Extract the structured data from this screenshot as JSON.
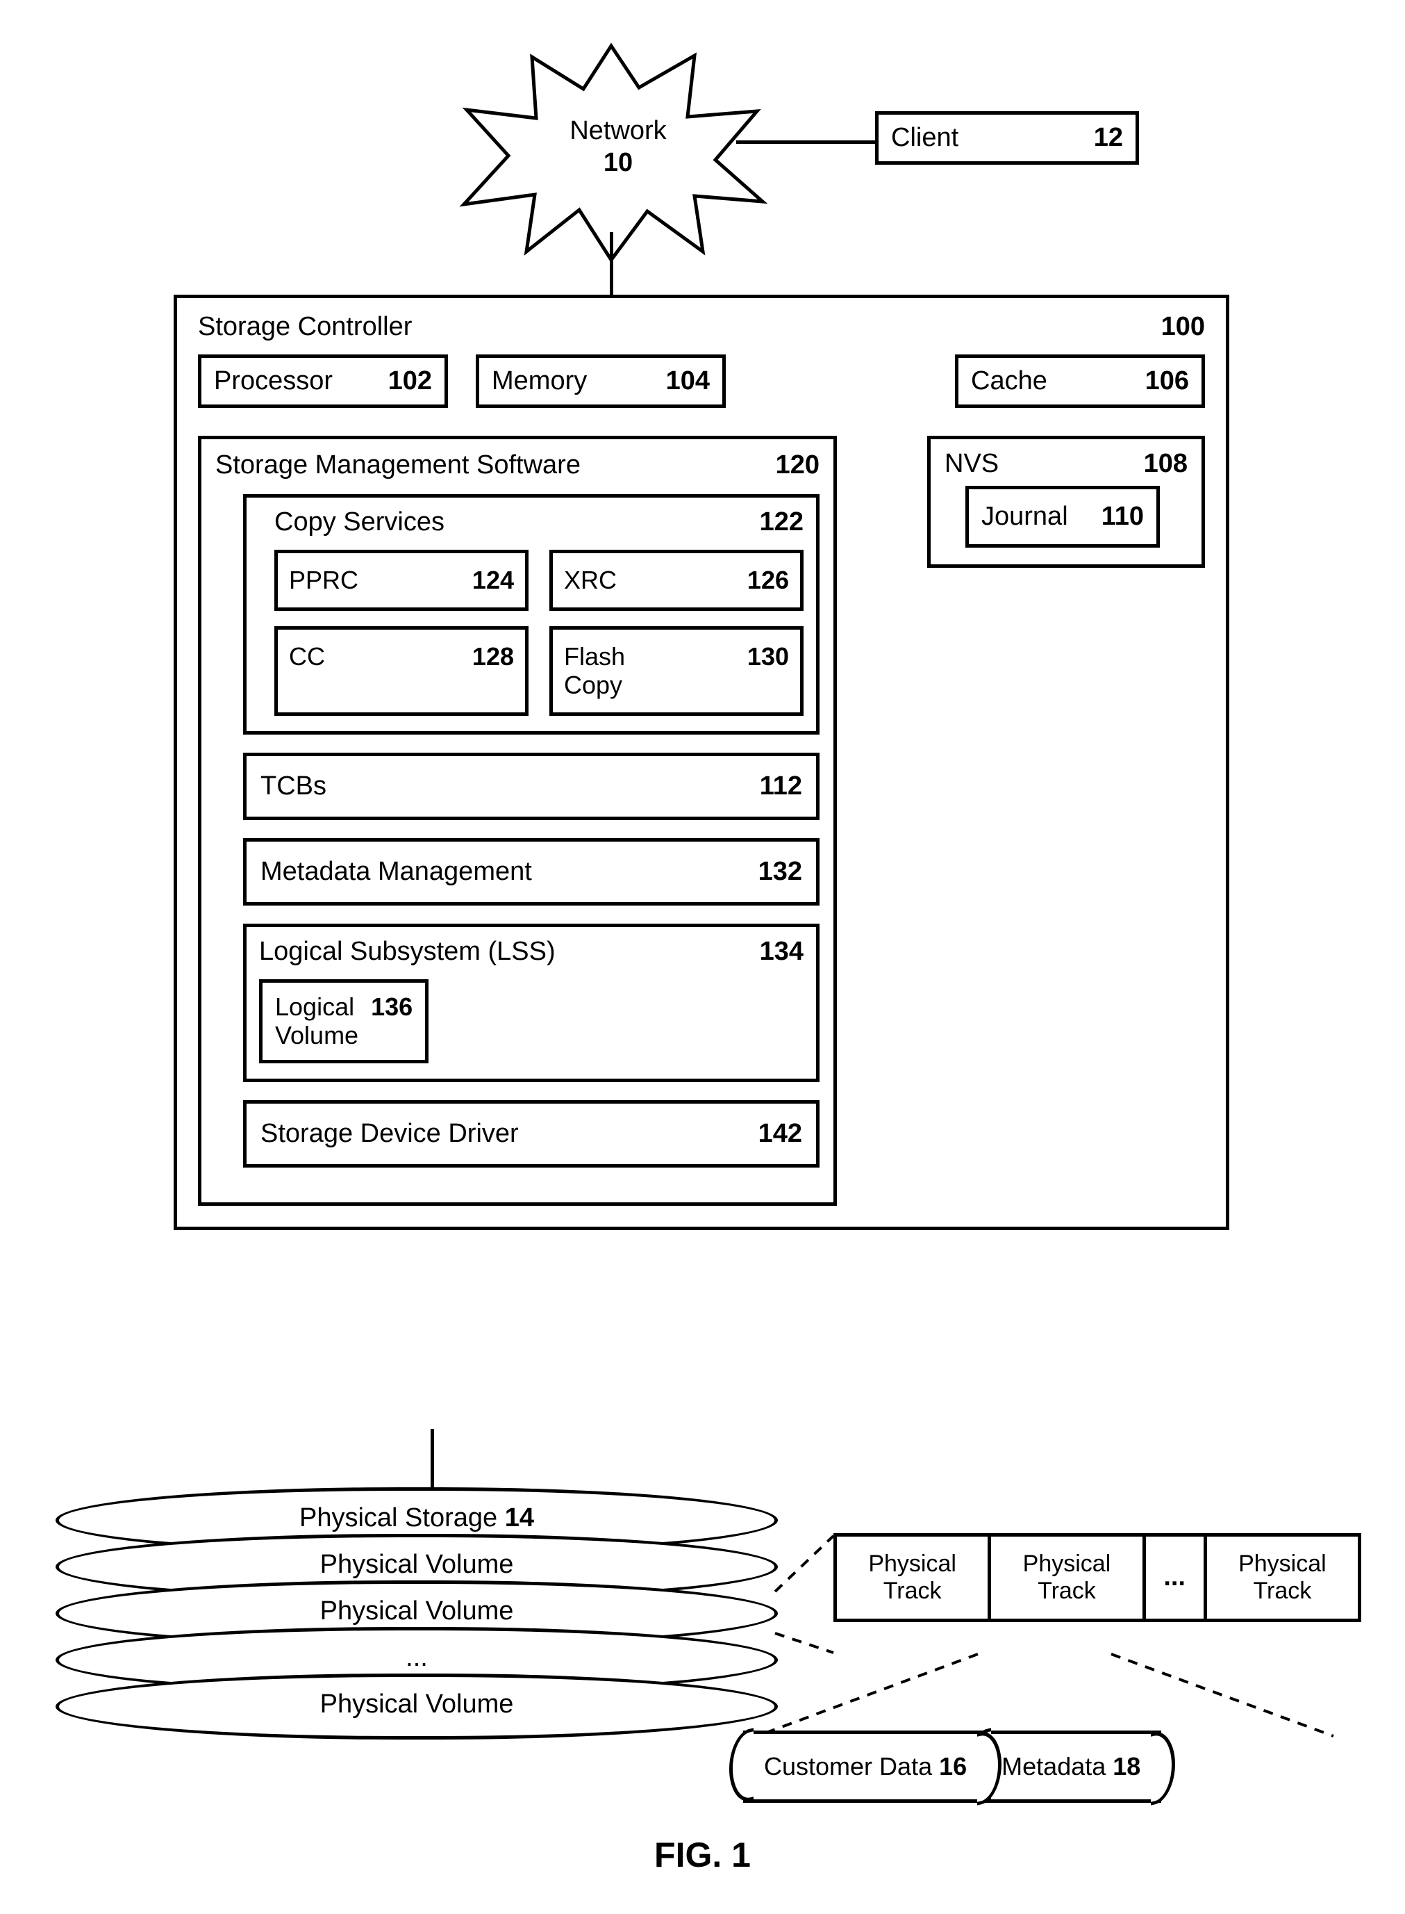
{
  "network": {
    "label": "Network",
    "num": "10"
  },
  "client": {
    "label": "Client",
    "num": "12"
  },
  "storage_controller": {
    "label": "Storage Controller",
    "num": "100",
    "processor": {
      "label": "Processor",
      "num": "102"
    },
    "memory": {
      "label": "Memory",
      "num": "104"
    },
    "cache": {
      "label": "Cache",
      "num": "106"
    },
    "nvs": {
      "label": "NVS",
      "num": "108",
      "journal": {
        "label": "Journal",
        "num": "110"
      }
    },
    "sms": {
      "label": "Storage Management Software",
      "num": "120",
      "copy_services": {
        "label": "Copy Services",
        "num": "122",
        "pprc": {
          "label": "PPRC",
          "num": "124"
        },
        "xrc": {
          "label": "XRC",
          "num": "126"
        },
        "cc": {
          "label": "CC",
          "num": "128"
        },
        "flash_copy": {
          "label": "Flash Copy",
          "num": "130"
        }
      },
      "tcbs": {
        "label": "TCBs",
        "num": "112"
      },
      "metadata_mgmt": {
        "label": "Metadata Management",
        "num": "132"
      },
      "lss": {
        "label": "Logical Subsystem (LSS)",
        "num": "134",
        "logical_volume": {
          "label": "Logical Volume",
          "num": "136"
        }
      },
      "storage_driver": {
        "label": "Storage Device Driver",
        "num": "142"
      }
    }
  },
  "physical_storage": {
    "label": "Physical Storage",
    "num": "14",
    "volumes": [
      "Physical Volume",
      "Physical Volume",
      "...",
      "Physical Volume"
    ]
  },
  "tracks": {
    "cells": [
      "Physical Track",
      "Physical Track",
      "...",
      "Physical Track"
    ]
  },
  "customer_data": {
    "label": "Customer Data",
    "num": "16"
  },
  "metadata": {
    "label": "Metadata",
    "num": "18"
  },
  "figure_label": "FIG. 1"
}
